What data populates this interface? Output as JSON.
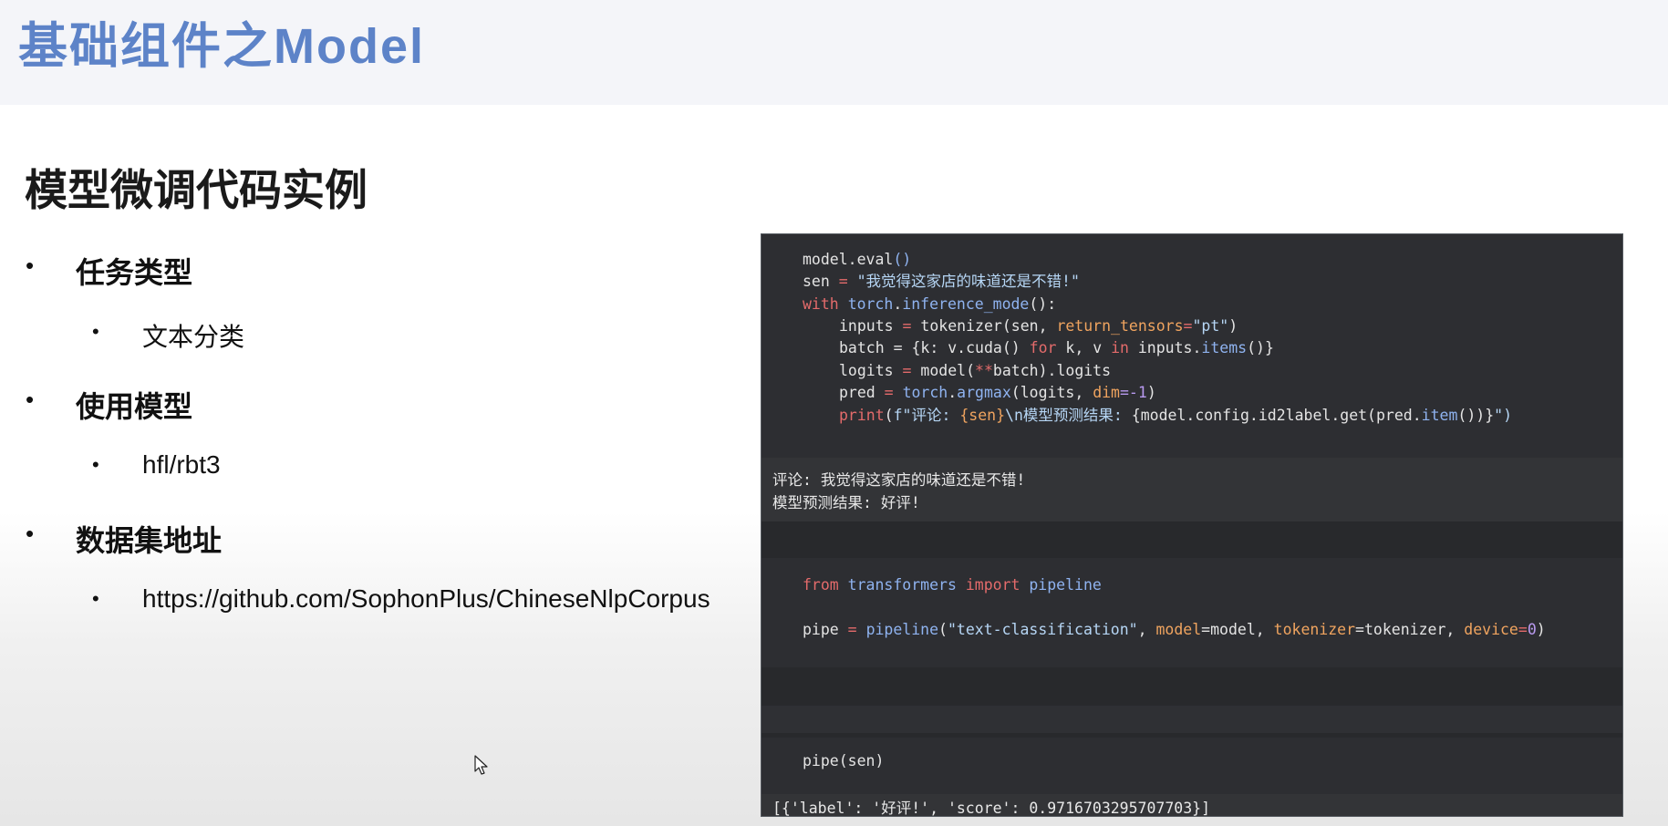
{
  "header": {
    "title": "基础组件之Model"
  },
  "section": {
    "title": "模型微调代码实例"
  },
  "bullets": [
    {
      "label": "任务类型",
      "sub": "文本分类"
    },
    {
      "label": "使用模型",
      "sub": "hfl/rbt3"
    },
    {
      "label": "数据集地址",
      "sub": "https://github.com/SophonPlus/ChineseNlpCorpus"
    }
  ],
  "code": {
    "cell1": {
      "line1": {
        "a": "model",
        "b": ".",
        "c": "eval",
        "d": "()"
      },
      "line2": {
        "a": "sen",
        "b": " = ",
        "c": "\"我觉得这家店的味道还是不错!\""
      },
      "line3": {
        "a": "with",
        "b": " ",
        "c": "torch",
        "d": ".",
        "e": "inference_mode",
        "f": "():"
      },
      "line4": {
        "a": "inputs",
        "b": " = ",
        "c": "tokenizer",
        "d": "(sen, ",
        "e": "return_tensors",
        "f": "=",
        "g": "\"pt\"",
        "h": ")"
      },
      "line5": {
        "a": "batch",
        "b": " = {k: v.",
        "c": "cuda",
        "d": "() ",
        "e": "for",
        "f": " k, v ",
        "g": "in",
        "h": " inputs.",
        "i": "items",
        "j": "()}"
      },
      "line6": {
        "a": "logits",
        "b": " = ",
        "c": "model",
        "d": "(",
        "e": "**",
        "f": "batch",
        "g": ").logits"
      },
      "line7": {
        "a": "pred",
        "b": " = ",
        "c": "torch",
        "d": ".",
        "e": "argmax",
        "f": "(logits, ",
        "g": "dim",
        "h": "=-1",
        "i": ")"
      },
      "line8": {
        "a": "print",
        "b": "(",
        "c": "f\"评论: ",
        "d": "{sen}",
        "e": "\\n模型预测结果: ",
        "f": "{model.config.id2label.get(pred.",
        "g": "item",
        "h": "())}",
        "i": "\")"
      }
    },
    "output1": {
      "line1": "评论: 我觉得这家店的味道还是不错!",
      "line2": "模型预测结果: 好评!"
    },
    "cell2": {
      "line1": {
        "a": "from",
        "b": " transformers ",
        "c": "import",
        "d": " pipeline"
      },
      "line2": {
        "a": "pipe",
        "b": " = ",
        "c": "pipeline",
        "d": "(",
        "e": "\"text-classification\"",
        "f": ", ",
        "g": "model",
        "h": "=model, ",
        "i": "tokenizer",
        "j": "=tokenizer, ",
        "k": "device",
        "l": "=",
        "m": "0",
        "n": ")"
      }
    },
    "cell3": {
      "line1": {
        "a": "pipe",
        "b": "(sen)"
      }
    },
    "output3": {
      "line1": "[{'label': '好评!', 'score': 0.9716703295707703}]"
    }
  }
}
